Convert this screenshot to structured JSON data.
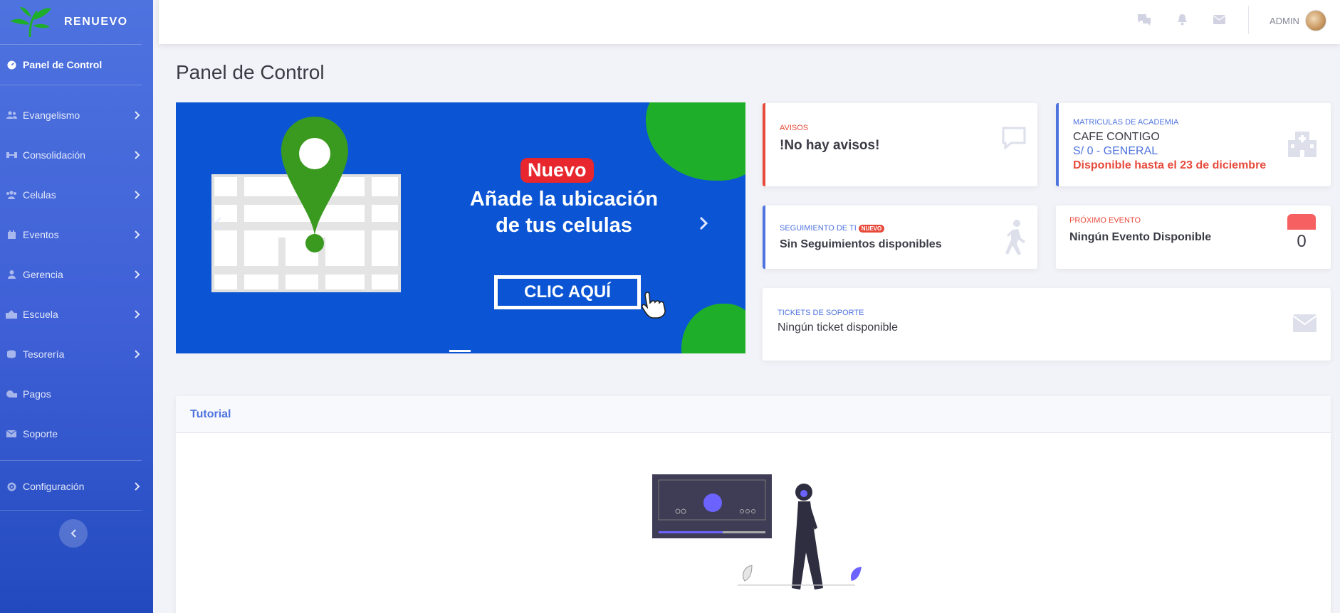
{
  "brand": {
    "name": "RENUEVO"
  },
  "sidebar": {
    "items": [
      {
        "label": "Panel de Control",
        "icon": "dashboard-icon",
        "active": true
      },
      {
        "label": "Evangelismo",
        "icon": "users-icon"
      },
      {
        "label": "Consolidación",
        "icon": "link-icon"
      },
      {
        "label": "Celulas",
        "icon": "group-icon"
      },
      {
        "label": "Eventos",
        "icon": "calendar-icon"
      },
      {
        "label": "Gerencia",
        "icon": "user-icon"
      },
      {
        "label": "Escuela",
        "icon": "school-icon"
      },
      {
        "label": "Tesorería",
        "icon": "coins-icon"
      },
      {
        "label": "Pagos",
        "icon": "payment-icon"
      },
      {
        "label": "Soporte",
        "icon": "envelope-icon"
      },
      {
        "label": "Configuración",
        "icon": "gear-icon"
      }
    ]
  },
  "topbar": {
    "user": "ADMIN",
    "icons": [
      "chat-icon",
      "bell-icon",
      "envelope-icon"
    ]
  },
  "page": {
    "title": "Panel de Control"
  },
  "carousel": {
    "badge": "Nuevo",
    "headline": "Añade la ubicación de tus celulas",
    "cta": "CLIC AQUÍ"
  },
  "cards": {
    "avisos": {
      "label": "AVISOS",
      "value": "!No hay avisos!"
    },
    "matriculas": {
      "label": "MATRICULAS DE ACADEMIA",
      "course": "CAFE CONTIGO",
      "price": "S/ 0 - GENERAL",
      "availability": "Disponible hasta el 23 de diciembre"
    },
    "seguimiento": {
      "label": "SEGUIMIENTO DE TI",
      "tag": "NUEVO",
      "value": "Sin Seguimientos disponibles"
    },
    "evento": {
      "label": "PRÓXIMO EVENTO",
      "value": "Ningún Evento Disponible",
      "count": "0"
    },
    "tickets": {
      "label": "TICKETS DE SOPORTE",
      "value": "Ningún ticket disponible"
    }
  },
  "tutorial": {
    "title": "Tutorial"
  },
  "colors": {
    "primary": "#4e73df",
    "danger": "#e74a3b",
    "green": "#1fae2a",
    "banner": "#0b55d4"
  }
}
